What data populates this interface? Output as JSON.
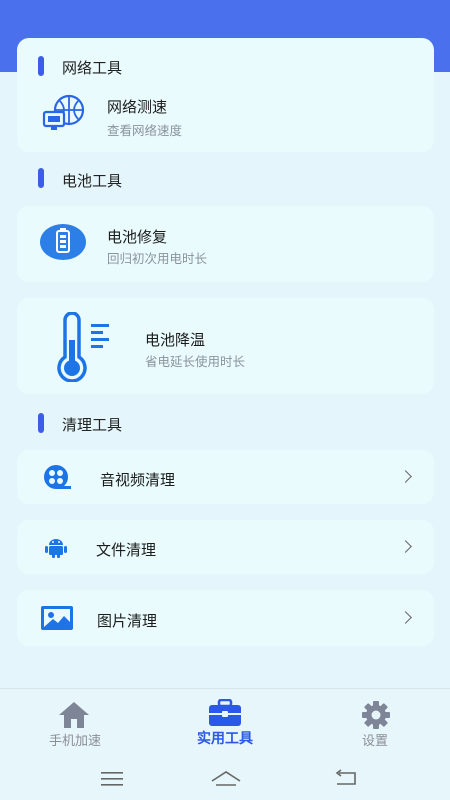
{
  "network_section": {
    "title": "网络工具",
    "item": {
      "title": "网络测速",
      "subtitle": "查看网络速度",
      "icon": "network-speed-icon"
    }
  },
  "battery_section": {
    "title": "电池工具",
    "items": [
      {
        "title": "电池修复",
        "subtitle": "回归初次用电时长",
        "icon": "battery-icon"
      },
      {
        "title": "电池降温",
        "subtitle": "省电延长使用时长",
        "icon": "thermometer-icon"
      }
    ]
  },
  "clean_section": {
    "title": "清理工具",
    "items": [
      {
        "title": "音视频清理",
        "icon": "film-reel-icon"
      },
      {
        "title": "文件清理",
        "icon": "android-icon"
      },
      {
        "title": "图片清理",
        "icon": "image-icon"
      }
    ]
  },
  "bottom_nav": {
    "items": [
      {
        "label": "手机加速",
        "icon": "home-icon"
      },
      {
        "label": "实用工具",
        "icon": "toolbox-icon",
        "active": true
      },
      {
        "label": "设置",
        "icon": "gear-icon"
      }
    ]
  },
  "system_nav": {
    "icons": [
      "menu-icon",
      "home-outline-icon",
      "back-icon"
    ]
  },
  "colors": {
    "accent": "#2b58e6",
    "header": "#4b70ee",
    "card": "#e9fbfd",
    "background": "#e4f6fb"
  }
}
